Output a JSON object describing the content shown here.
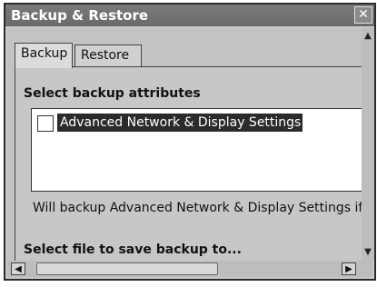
{
  "window": {
    "title": "Backup & Restore",
    "close_glyph": "✕"
  },
  "tabs": [
    {
      "label": "Backup",
      "active": true
    },
    {
      "label": "Restore",
      "active": false
    }
  ],
  "backup": {
    "attributes_heading": "Select backup attributes",
    "attributes": [
      {
        "label": "Advanced Network & Display Settings",
        "checked": false,
        "selected": true
      }
    ],
    "info_text": "Will backup Advanced Network & Display Settings if",
    "file_heading": "Select file to save backup to..."
  },
  "scrollbars": {
    "up_icon": "▲",
    "down_icon": "▼",
    "left_icon": "◀",
    "right_icon": "▶"
  }
}
